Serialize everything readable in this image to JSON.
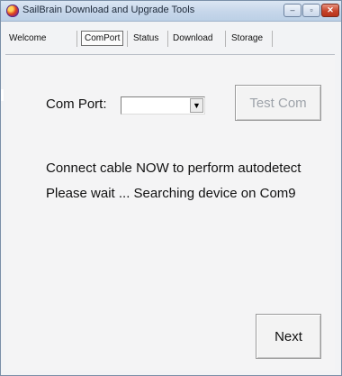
{
  "window": {
    "title": "SailBrain Download and Upgrade Tools",
    "controls": {
      "minimize": "‒",
      "maximize": "▫",
      "close": "✕"
    }
  },
  "tabs": [
    {
      "label": "Welcome",
      "active": false
    },
    {
      "label": "ComPort",
      "active": true
    },
    {
      "label": "Status",
      "active": false
    },
    {
      "label": "Download",
      "active": false
    },
    {
      "label": "Storage",
      "active": false
    }
  ],
  "comport": {
    "label": "Com Port:",
    "selected_value": "",
    "test_button": "Test Com",
    "test_button_enabled": false
  },
  "messages": {
    "line1": "Connect cable NOW to perform autodetect",
    "line2": "Please wait ... Searching device on Com9"
  },
  "footer": {
    "next_button": "Next"
  },
  "colors": {
    "titlebar": "#c6d6ea",
    "panel": "#f4f4f5",
    "disabled_text": "#9ea3aa"
  }
}
